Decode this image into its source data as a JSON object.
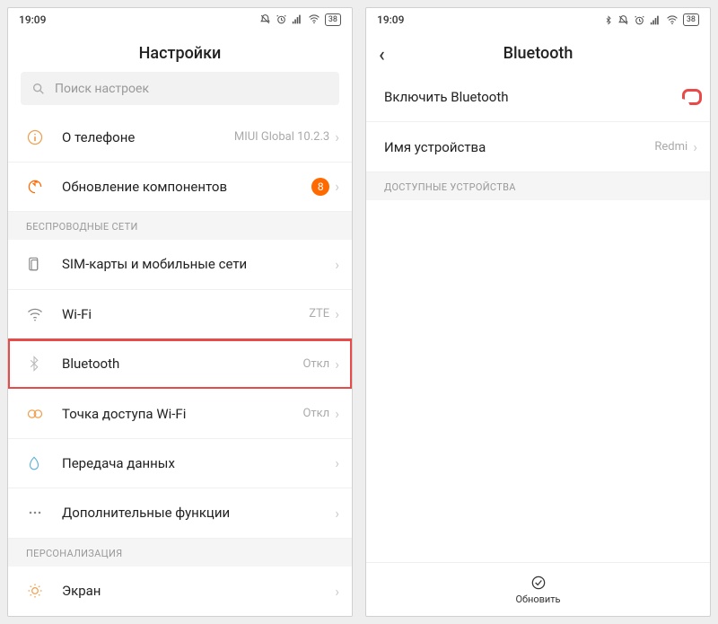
{
  "left": {
    "statusbar": {
      "time": "19:09",
      "battery": "38"
    },
    "title": "Настройки",
    "search_placeholder": "Поиск настроек",
    "rows": {
      "about": {
        "label": "О телефоне",
        "value": "MIUI Global 10.2.3"
      },
      "updates": {
        "label": "Обновление компонентов",
        "badge": "8"
      }
    },
    "section_wireless": "БЕСПРОВОДНЫЕ СЕТИ",
    "wireless": {
      "sim": {
        "label": "SIM-карты и мобильные сети"
      },
      "wifi": {
        "label": "Wi-Fi",
        "value": "ZTE"
      },
      "bluetooth": {
        "label": "Bluetooth",
        "value": "Откл"
      },
      "hotspot": {
        "label": "Точка доступа Wi-Fi",
        "value": "Откл"
      },
      "data": {
        "label": "Передача данных"
      },
      "more": {
        "label": "Дополнительные функции"
      }
    },
    "section_personal": "ПЕРСОНАЛИЗАЦИЯ",
    "personal": {
      "display": {
        "label": "Экран"
      }
    }
  },
  "right": {
    "statusbar": {
      "time": "19:09",
      "battery": "38"
    },
    "title": "Bluetooth",
    "enable": {
      "label": "Включить Bluetooth"
    },
    "device_name": {
      "label": "Имя устройства",
      "value": "Redmi"
    },
    "section_available": "ДОСТУПНЫЕ УСТРОЙСТВА",
    "refresh": "Обновить"
  }
}
